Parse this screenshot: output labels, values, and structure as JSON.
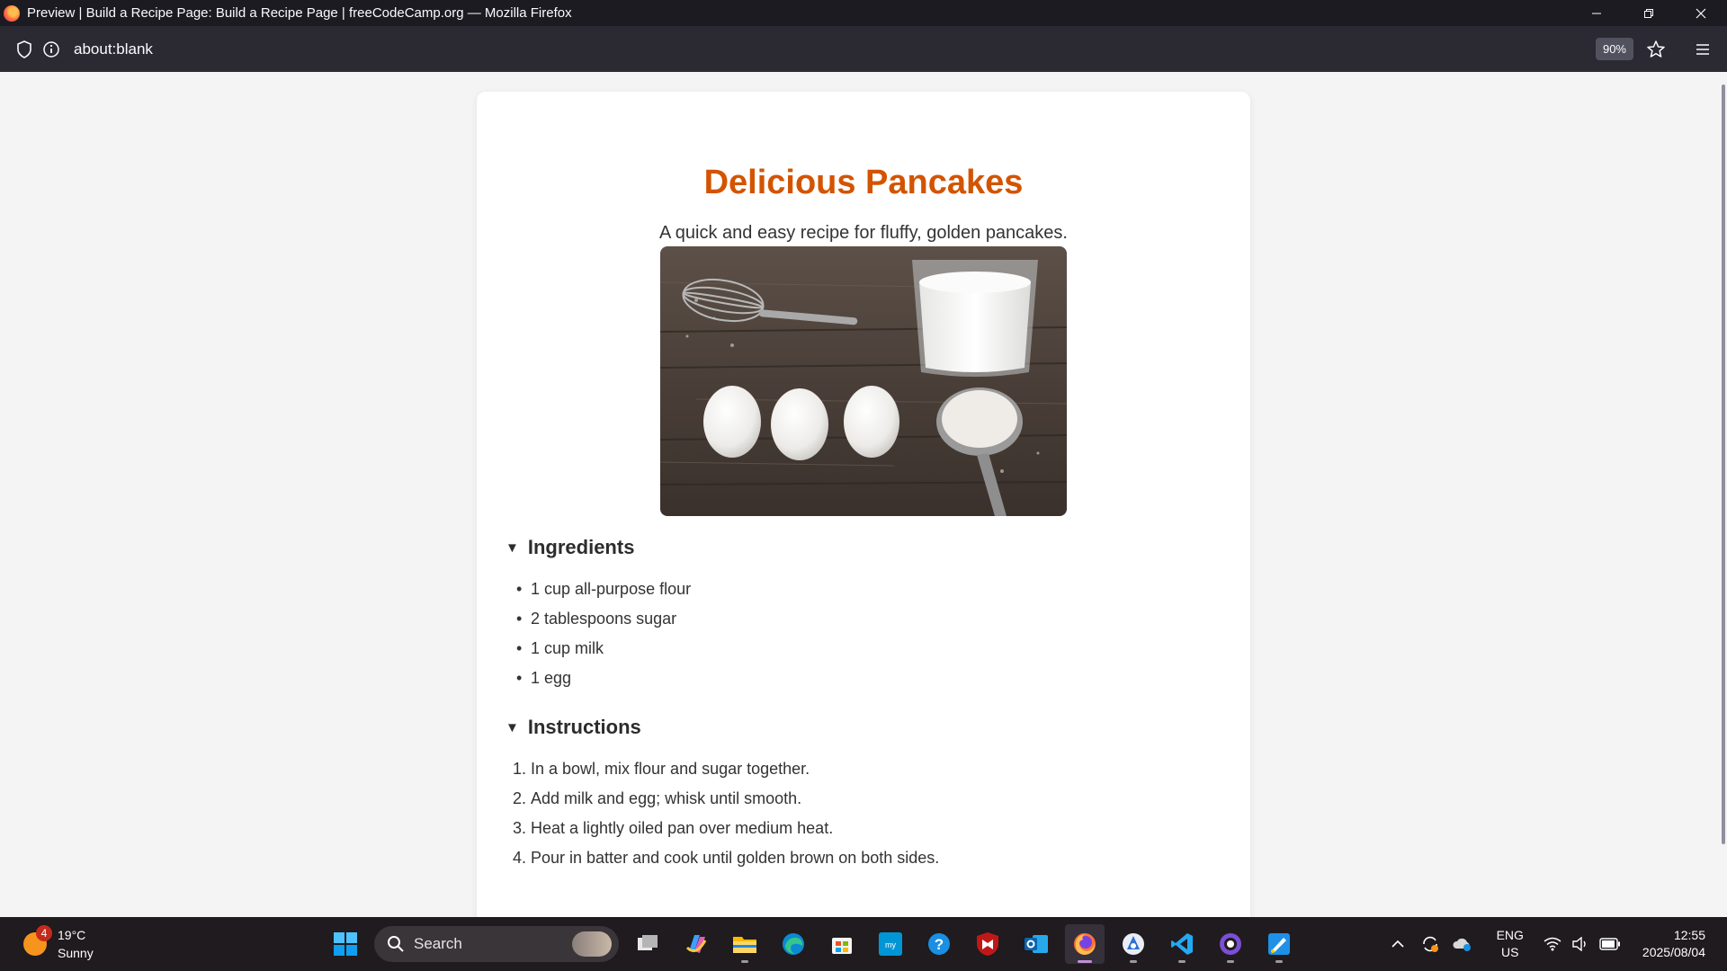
{
  "window": {
    "title": "Preview | Build a Recipe Page: Build a Recipe Page | freeCodeCamp.org — Mozilla Firefox"
  },
  "navbar": {
    "url": "about:blank",
    "zoom": "90%"
  },
  "recipe": {
    "title": "Delicious Pancakes",
    "tagline": "A quick and easy recipe for fluffy, golden pancakes.",
    "ingredients_heading": "Ingredients",
    "ingredients": [
      "1 cup all-purpose flour",
      "2 tablespoons sugar",
      "1 cup milk",
      "1 egg"
    ],
    "instructions_heading": "Instructions",
    "instructions": [
      "In a bowl, mix flour and sugar together.",
      "Add milk and egg; whisk until smooth.",
      "Heat a lightly oiled pan over medium heat.",
      "Pour in batter and cook until golden brown on both sides."
    ],
    "title_color": "#d35400"
  },
  "taskbar": {
    "weather_temp": "19°C",
    "weather_desc": "Sunny",
    "weather_badge": "4",
    "search_label": "Search",
    "lang_line1": "ENG",
    "lang_line2": "US",
    "time": "12:55",
    "date": "2025/08/04",
    "apps": [
      "task-view-icon",
      "copilot-icon",
      "file-explorer-icon",
      "edge-icon",
      "microsoft-store-icon",
      "myhp-icon",
      "help-icon",
      "mcafee-icon",
      "outlook-icon",
      "firefox-icon",
      "app-icon",
      "vscode-icon",
      "github-desktop-icon",
      "paint-icon"
    ]
  }
}
